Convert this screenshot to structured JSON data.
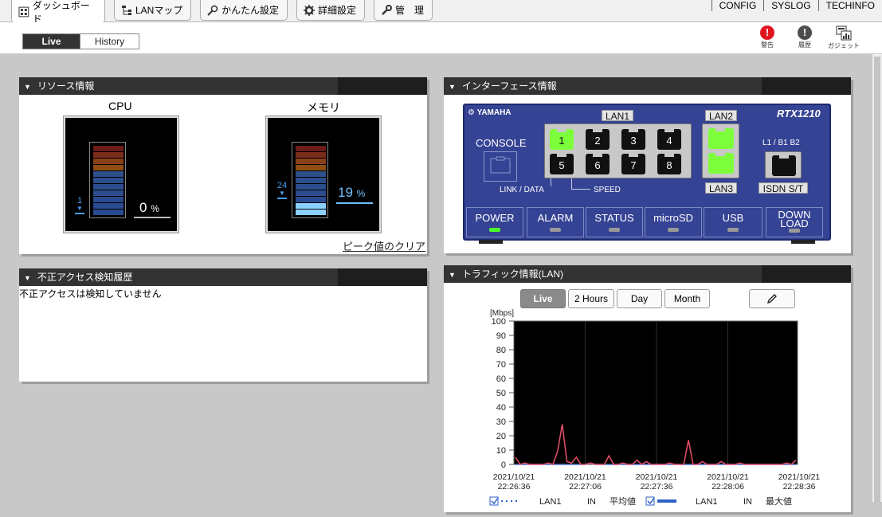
{
  "nav": {
    "tabs": [
      {
        "label": "ダッシュボード",
        "icon": "dashboard-icon"
      },
      {
        "label": "LANマップ",
        "icon": "lanmap-icon"
      },
      {
        "label": "かんたん設定",
        "icon": "wand-icon"
      },
      {
        "label": "詳細設定",
        "icon": "gear-icon"
      },
      {
        "label": "管　理",
        "icon": "wrench-icon"
      }
    ],
    "links": [
      "CONFIG",
      "SYSLOG",
      "TECHINFO"
    ]
  },
  "subbar": {
    "live_label": "Live",
    "history_label": "History",
    "tools": [
      {
        "label": "警告",
        "icon": "warning-icon",
        "color": "#e0141e"
      },
      {
        "label": "履歴",
        "icon": "history-icon",
        "color": "#4d4d4d"
      },
      {
        "label": "ガジェット",
        "icon": "gadget-icon"
      }
    ]
  },
  "resource": {
    "title": "リソース情報",
    "cpu": {
      "label": "CPU",
      "percent": "0",
      "unit": "%",
      "marker": "1",
      "level": 0
    },
    "memory": {
      "label": "メモリ",
      "percent": "19",
      "unit": "%",
      "marker": "24",
      "level": 19
    },
    "clear_peak": "ピーク値のクリア"
  },
  "intrusion": {
    "title": "不正アクセス検知履歴",
    "message": "不正アクセスは検知していません"
  },
  "interface": {
    "title": "インターフェース情報",
    "brand": "YAMAHA",
    "model": "RTX1210",
    "console": "CONSOLE",
    "lan1": "LAN1",
    "lan2": "LAN2",
    "lan3": "LAN3",
    "ports": [
      "1",
      "2",
      "3",
      "4",
      "5",
      "6",
      "7",
      "8"
    ],
    "lit_ports": [
      "1"
    ],
    "link_data": "LINK / DATA",
    "speed": "SPEED",
    "isdn_top": "L1 / B1 B2",
    "isdn": "ISDN S/T",
    "leds": [
      {
        "label": "POWER",
        "on": true
      },
      {
        "label": "ALARM",
        "on": false
      },
      {
        "label": "STATUS",
        "on": false
      },
      {
        "label": "microSD",
        "on": false
      },
      {
        "label": "USB",
        "on": false
      },
      {
        "label": "DOWN LOAD",
        "on": false
      }
    ]
  },
  "traffic": {
    "title": "トラフィック情報(LAN)",
    "ranges": [
      "Live",
      "2 Hours",
      "Day",
      "Month"
    ],
    "edit_icon": "pencil-icon",
    "legend": [
      {
        "label": "LAN1",
        "dir": "IN",
        "kind": "平均値"
      },
      {
        "label": "LAN1",
        "dir": "IN",
        "kind": "最大値"
      }
    ]
  },
  "chart_data": {
    "type": "line",
    "ylabel": "[Mbps]",
    "ylim": [
      0,
      100
    ],
    "yticks": [
      0,
      10,
      20,
      30,
      40,
      50,
      60,
      70,
      80,
      90,
      100
    ],
    "xticks": [
      [
        "2021/10/21",
        "22:26:36"
      ],
      [
        "2021/10/21",
        "22:27:06"
      ],
      [
        "2021/10/21",
        "22:27:36"
      ],
      [
        "2021/10/21",
        "22:28:06"
      ],
      [
        "2021/10/21",
        "22:28:36"
      ]
    ],
    "series": [
      {
        "color": "#4b70d8",
        "values": [
          0,
          0,
          0,
          0,
          0,
          0,
          0,
          0,
          0,
          0,
          0,
          0,
          0,
          0,
          0,
          0,
          1,
          0,
          0,
          0,
          0,
          0,
          0,
          0,
          0,
          0,
          0,
          0,
          0,
          0,
          0,
          0,
          0,
          0,
          0,
          0,
          0,
          0,
          0,
          0,
          0,
          0,
          0,
          0,
          0,
          0,
          0,
          0,
          0,
          0,
          0,
          0,
          0,
          0,
          0,
          0,
          0,
          0,
          0,
          0,
          0
        ]
      },
      {
        "color": "#e8506a",
        "values": [
          5,
          0,
          1,
          0,
          0,
          0,
          0,
          1,
          0,
          9,
          28,
          2,
          1,
          5,
          0,
          0,
          1,
          0,
          0,
          0,
          6,
          0,
          0,
          1,
          0,
          0,
          3,
          0,
          2,
          0,
          0,
          0,
          0,
          1,
          0,
          0,
          0,
          17,
          0,
          0,
          2,
          0,
          0,
          0,
          2,
          0,
          0,
          0,
          1,
          0,
          0,
          0,
          0,
          0,
          0,
          0,
          0,
          0,
          1,
          0,
          3
        ]
      }
    ]
  }
}
